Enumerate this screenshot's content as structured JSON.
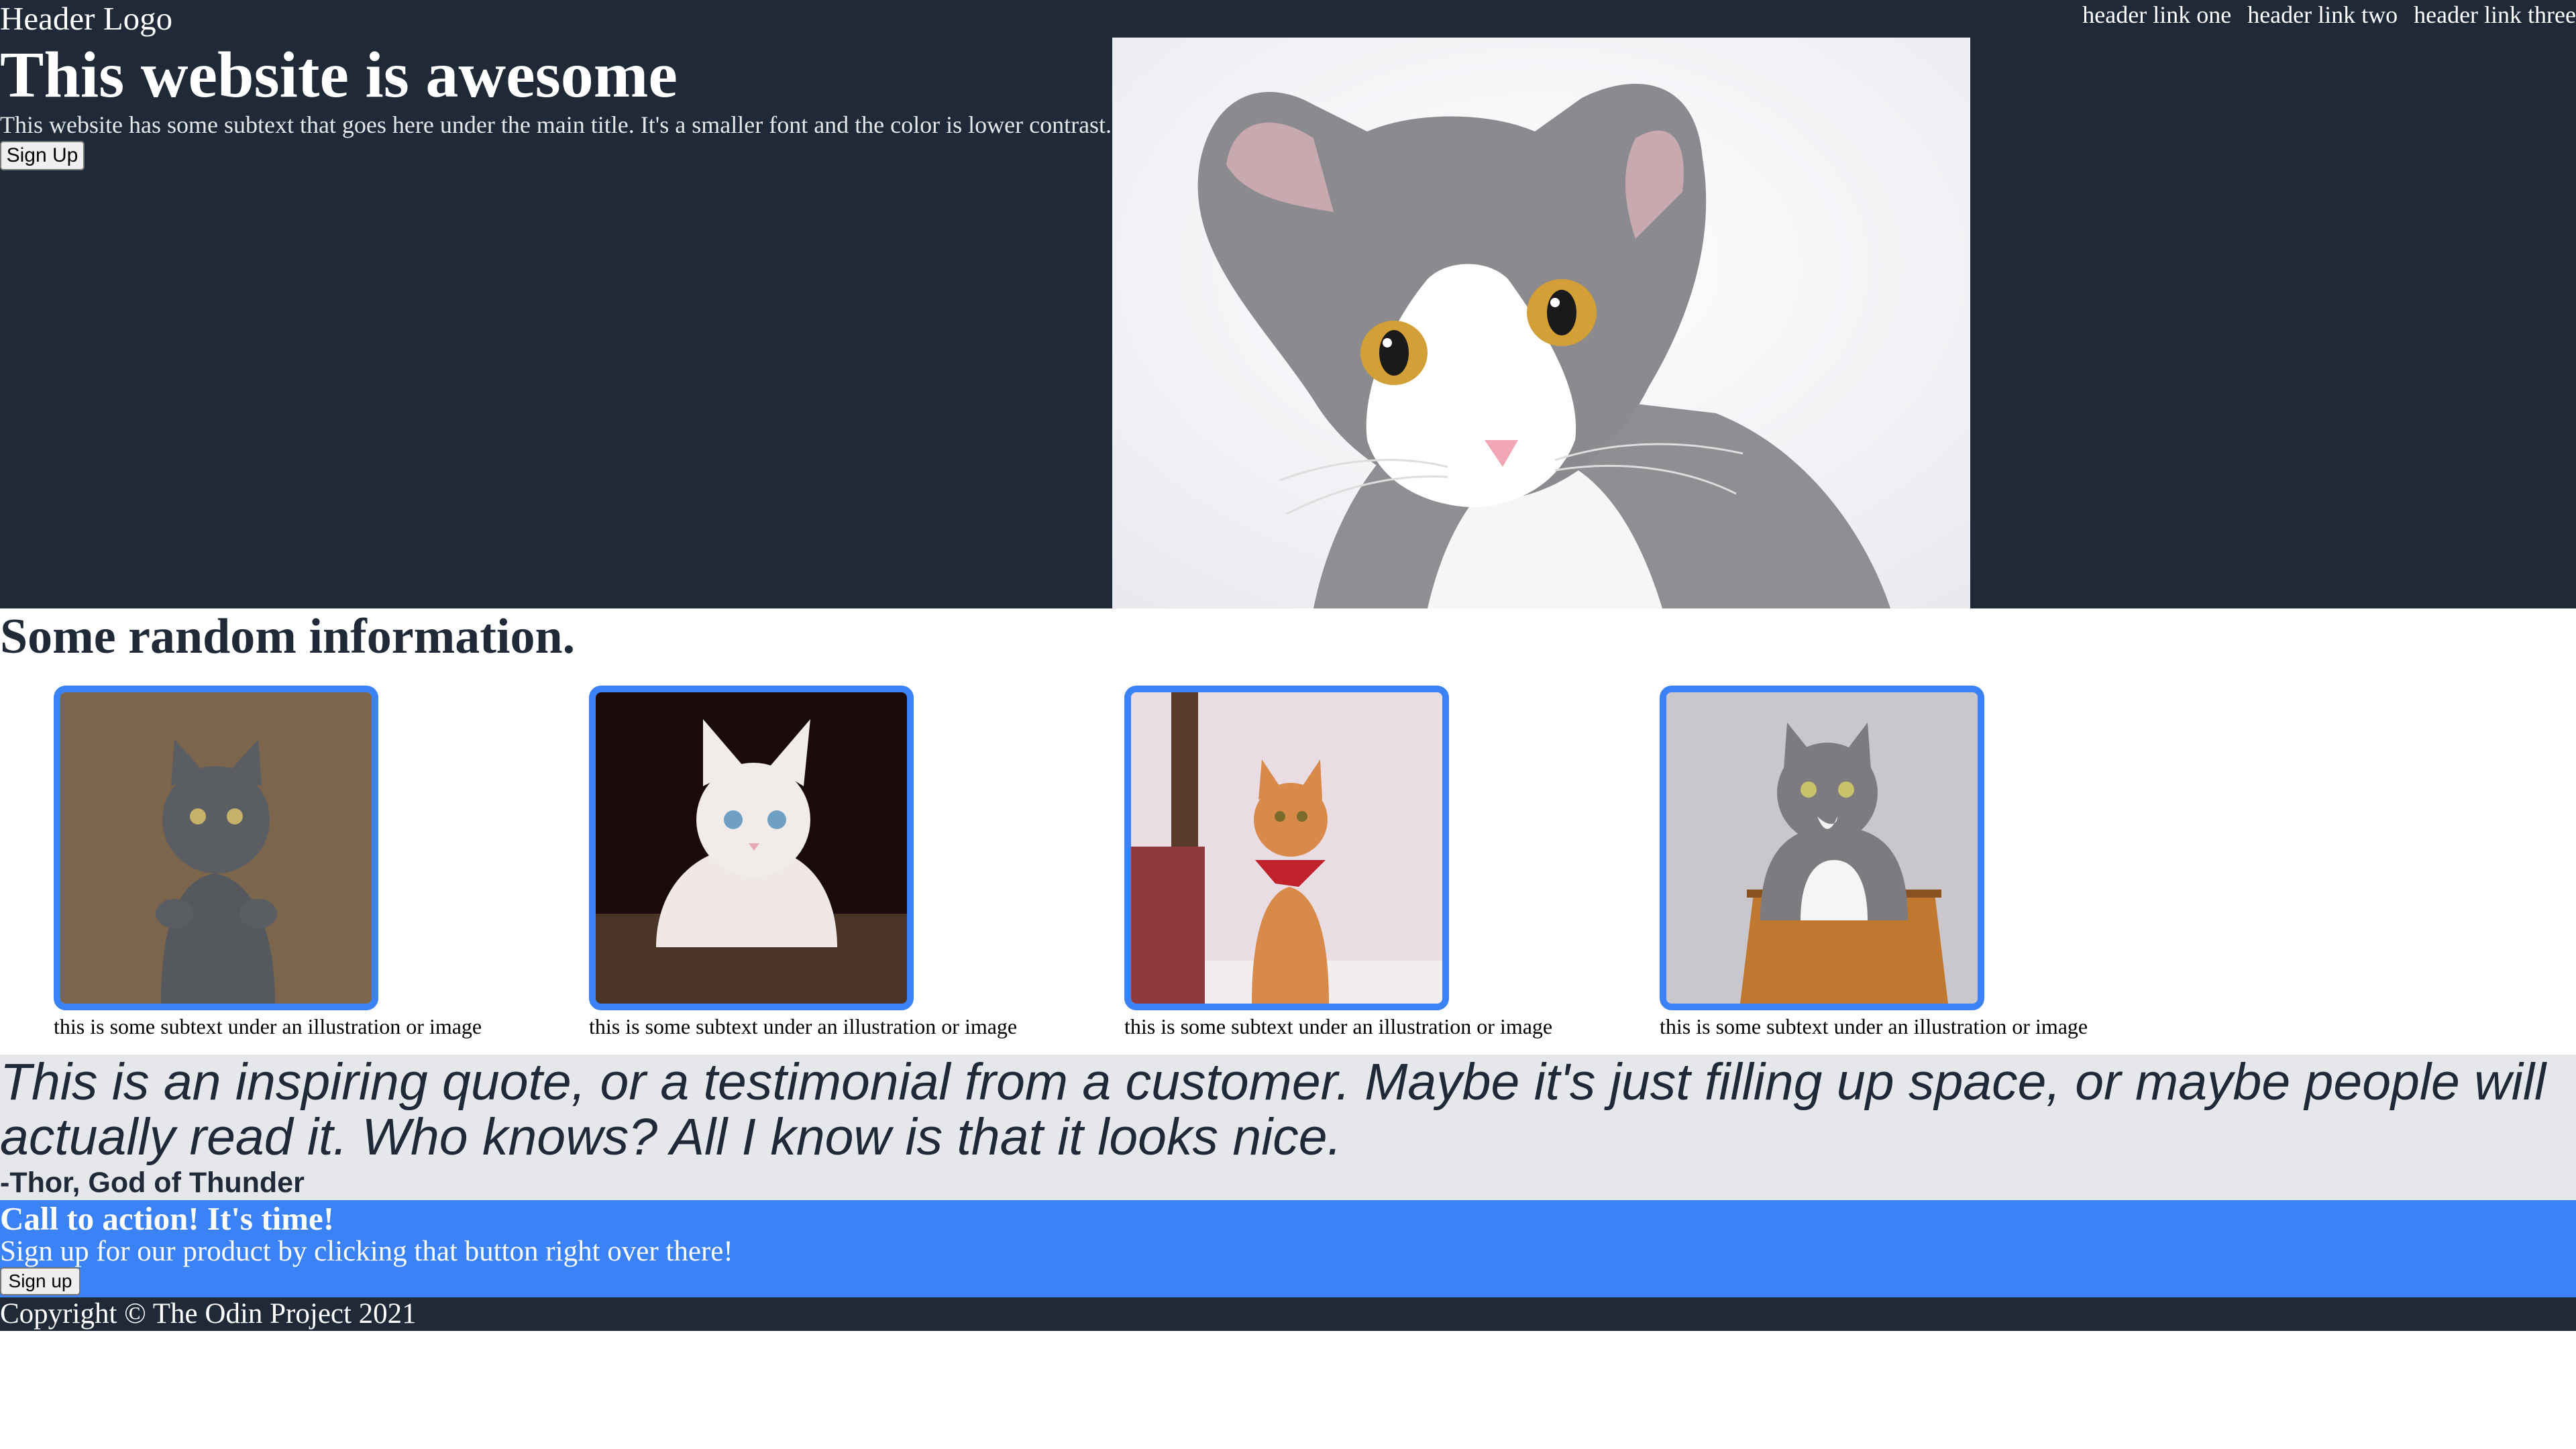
{
  "header": {
    "logo": "Header Logo",
    "links": [
      "header link one",
      "header link two",
      "header link three"
    ]
  },
  "hero": {
    "title": "This website is awesome",
    "subtitle": "This website has some subtext that goes here under the main title. It's a smaller font and the color is lower contrast.",
    "button_label": "Sign Up",
    "image_icon": "cat-photo"
  },
  "info": {
    "title": "Some random information.",
    "cards": [
      {
        "caption": "this is some subtext under an illustration or image",
        "icon": "cat-photo"
      },
      {
        "caption": "this is some subtext under an illustration or image",
        "icon": "cat-photo"
      },
      {
        "caption": "this is some subtext under an illustration or image",
        "icon": "cat-photo"
      },
      {
        "caption": "this is some subtext under an illustration or image",
        "icon": "cat-photo"
      }
    ]
  },
  "quote": {
    "text": "This is an inspiring quote, or a testimonial from a customer. Maybe it's just filling up space, or maybe people will actually read it. Who knows? All I know is that it looks nice.",
    "author": "-Thor, God of Thunder"
  },
  "cta": {
    "title": "Call to action! It's time!",
    "subtitle": "Sign up for our product by clicking that button right over there!",
    "button_label": "Sign up"
  },
  "footer": {
    "copyright": "Copyright © The Odin Project 2021"
  },
  "colors": {
    "dark": "#1f2937",
    "accent": "#3b82f6",
    "light_gray": "#e5e7eb"
  }
}
